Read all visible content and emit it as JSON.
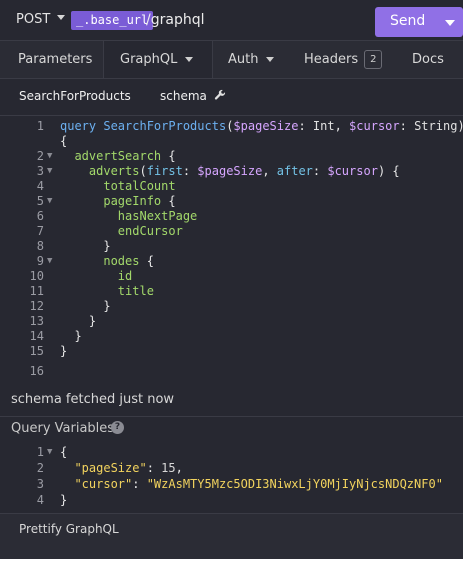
{
  "urlbar": {
    "method": "POST",
    "base_url_tag": "_.base_url",
    "path": "/graphql",
    "send_label": "Send"
  },
  "tabs": [
    {
      "label": "Parameters"
    },
    {
      "label": "GraphQL"
    },
    {
      "label": "Auth"
    },
    {
      "label": "Headers",
      "badge": "2"
    },
    {
      "label": "Docs"
    }
  ],
  "subtabs": {
    "operation": "SearchForProducts",
    "schema": "schema"
  },
  "editor": {
    "line_numbers": [
      "1",
      "2",
      "3",
      "4",
      "5",
      "6",
      "7",
      "8",
      "9",
      "10",
      "11",
      "12",
      "13",
      "14",
      "15",
      "16"
    ],
    "lines": [
      "query SearchForProducts($pageSize: Int, $cursor: String)",
      "{",
      "  advertSearch {",
      "    adverts(first: $pageSize, after: $cursor) {",
      "      totalCount",
      "      pageInfo {",
      "        hasNextPage",
      "        endCursor",
      "      }",
      "      nodes {",
      "        id",
      "        title",
      "      }",
      "    }",
      "  }",
      "}",
      ""
    ]
  },
  "schema_status": "schema fetched just now",
  "query_variables": {
    "title": "Query Variables",
    "help_icon": "?",
    "line_numbers": [
      "1",
      "2",
      "3",
      "4"
    ],
    "lines": [
      "{",
      "  \"pageSize\": 15,",
      "  \"cursor\": \"WzAsMTY5Mzc5ODI3NiwxLjY0MjIyNjcsNDQzNF0\"",
      "}"
    ]
  },
  "footer": {
    "prettify_label": "Prettify GraphQL"
  }
}
